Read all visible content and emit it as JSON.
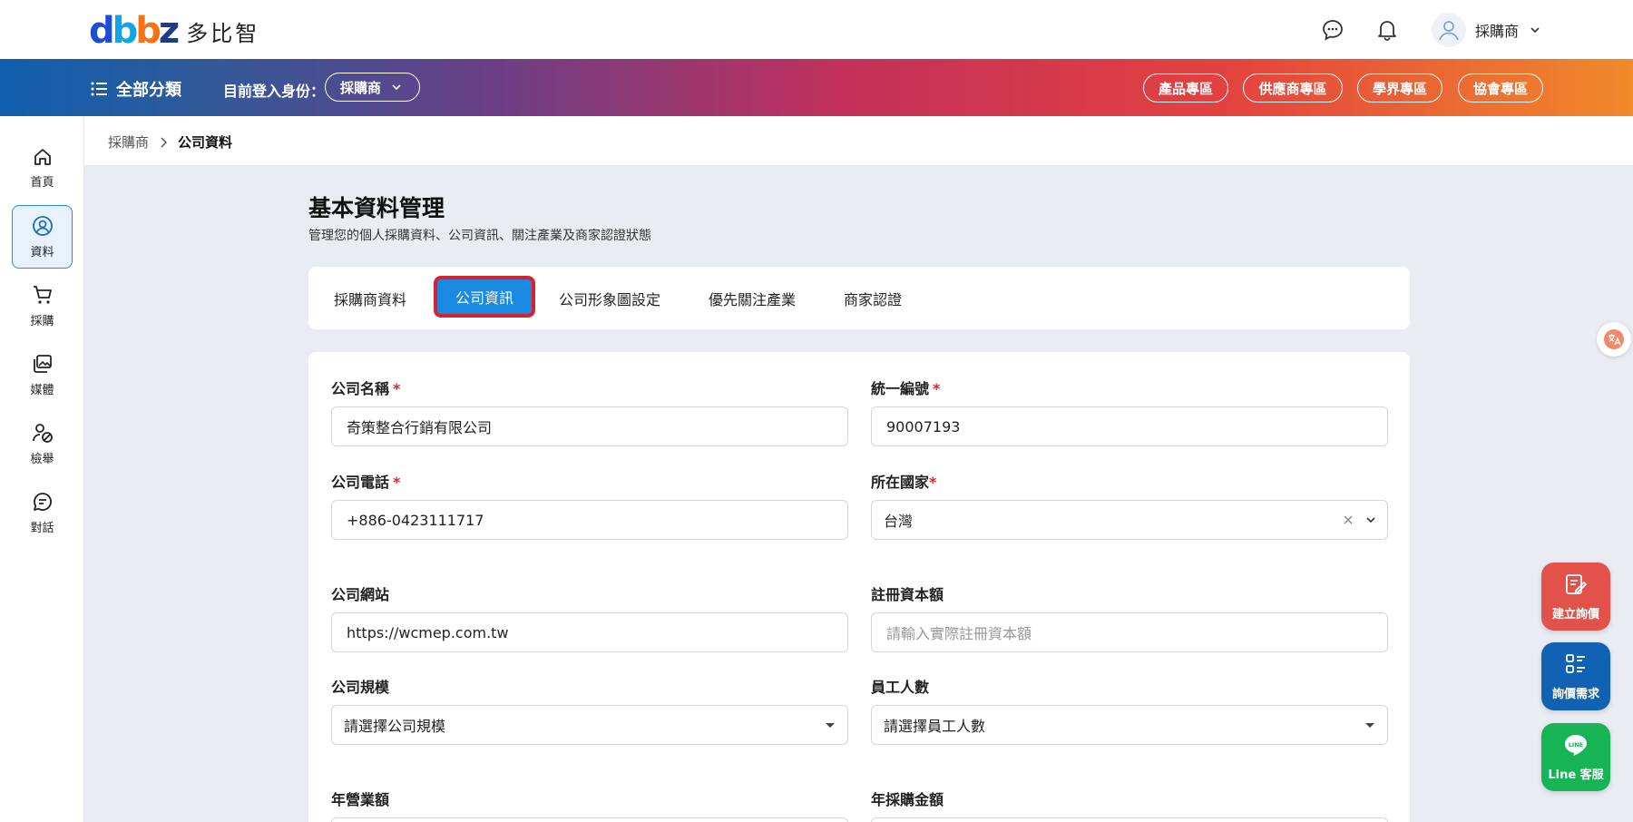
{
  "header": {
    "logo_mark": "dbbz",
    "logo_text": "多比智",
    "user_name": "採購商"
  },
  "navbar": {
    "all_categories": "全部分類",
    "identity_label": "目前登入身份：",
    "identity_value": "採購商",
    "zones": [
      "產品專區",
      "供應商專區",
      "學界專區",
      "協會專區"
    ]
  },
  "sidebar": {
    "items": [
      {
        "label": "首頁",
        "icon": "home-icon"
      },
      {
        "label": "資料",
        "icon": "user-circle-icon"
      },
      {
        "label": "採購",
        "icon": "cart-icon"
      },
      {
        "label": "媒體",
        "icon": "media-icon"
      },
      {
        "label": "檢舉",
        "icon": "user-block-icon"
      },
      {
        "label": "對話",
        "icon": "chat-icon"
      }
    ]
  },
  "breadcrumb": {
    "parent": "採購商",
    "current": "公司資料"
  },
  "page": {
    "title": "基本資料管理",
    "subtitle": "管理您的個人採購資料、公司資訊、關注產業及商家認證狀態"
  },
  "tabs": [
    "採購商資料",
    "公司資訊",
    "公司形象圖設定",
    "優先關注產業",
    "商家認證"
  ],
  "form": {
    "company_name": {
      "label": "公司名稱",
      "value": "奇策整合行銷有限公司"
    },
    "tax_id": {
      "label": "統一編號",
      "value": "90007193"
    },
    "phone": {
      "label": "公司電話",
      "value": "+886-0423111717"
    },
    "country": {
      "label": "所在國家",
      "value": "台灣"
    },
    "website": {
      "label": "公司網站",
      "value": "https://wcmep.com.tw"
    },
    "capital": {
      "label": "註冊資本額",
      "placeholder": "請輸入實際註冊資本額"
    },
    "scale": {
      "label": "公司規模",
      "value": "請選擇公司規模"
    },
    "employees": {
      "label": "員工人數",
      "value": "請選擇員工人數"
    },
    "revenue": {
      "label": "年營業額"
    },
    "purchase": {
      "label": "年採購金額"
    }
  },
  "fabs": [
    {
      "label": "建立詢價",
      "color": "#e0524a"
    },
    {
      "label": "詢價需求",
      "color": "#1262b3"
    },
    {
      "label": "Line 客服",
      "color": "#16b455"
    }
  ]
}
